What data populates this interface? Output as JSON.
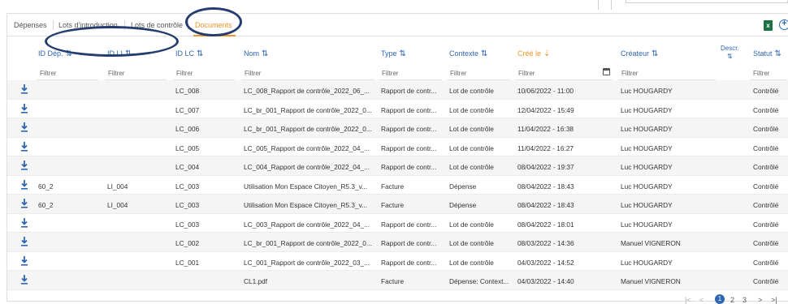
{
  "tabs": [
    "Dépenses",
    "Lots d'introduction",
    "Lots de contrôle",
    "Documents"
  ],
  "active_tab": "Documents",
  "toolbar": {
    "excel_icon": "excel-export-icon",
    "excel_glyph": "x",
    "add_icon": "add-circle-icon",
    "add_glyph": "+"
  },
  "columns": [
    {
      "key": "id_dep",
      "label": "ID Dép.",
      "sort": "⇅"
    },
    {
      "key": "id_li",
      "label": "ID LI",
      "sort": "⇅"
    },
    {
      "key": "id_lc",
      "label": "ID LC",
      "sort": "⇅"
    },
    {
      "key": "nom",
      "label": "Nom",
      "sort": "⇅"
    },
    {
      "key": "type",
      "label": "Type",
      "sort": "⇅"
    },
    {
      "key": "contexte",
      "label": "Contexte",
      "sort": "⇅"
    },
    {
      "key": "cree_le",
      "label": "Créé le",
      "sort": "⇣",
      "sorted": true
    },
    {
      "key": "createur",
      "label": "Créateur",
      "sort": "⇅"
    },
    {
      "key": "descr",
      "label": "Descr.",
      "sort": "⇅"
    },
    {
      "key": "statut",
      "label": "Statut",
      "sort": "⇅"
    }
  ],
  "filter_placeholder": "Filtrer",
  "download_icon": "download-icon",
  "calendar_icon": "calendar-icon",
  "rows": [
    {
      "id_dep": "",
      "id_li": "",
      "id_lc": "LC_008",
      "nom": "LC_008_Rapport de contrôle_2022_06_...",
      "type": "Rapport de contr...",
      "contexte": "Lot de contrôle",
      "cree_le": "10/06/2022 - 11:00",
      "createur": "Luc HOUGARDY",
      "statut": "Contrôlé"
    },
    {
      "id_dep": "",
      "id_li": "",
      "id_lc": "LC_007",
      "nom": "LC_br_001_Rapport de contrôle_2022_0...",
      "type": "Rapport de contr...",
      "contexte": "Lot de contrôle",
      "cree_le": "12/04/2022 - 15:49",
      "createur": "Luc HOUGARDY",
      "statut": "Contrôlé"
    },
    {
      "id_dep": "",
      "id_li": "",
      "id_lc": "LC_006",
      "nom": "LC_br_001_Rapport de contrôle_2022_0...",
      "type": "Rapport de contr...",
      "contexte": "Lot de contrôle",
      "cree_le": "11/04/2022 - 16:38",
      "createur": "Luc HOUGARDY",
      "statut": "Contrôlé"
    },
    {
      "id_dep": "",
      "id_li": "",
      "id_lc": "LC_005",
      "nom": "LC_005_Rapport de contrôle_2022_04_...",
      "type": "Rapport de contr...",
      "contexte": "Lot de contrôle",
      "cree_le": "11/04/2022 - 16:27",
      "createur": "Luc HOUGARDY",
      "statut": "Contrôlé"
    },
    {
      "id_dep": "",
      "id_li": "",
      "id_lc": "LC_004",
      "nom": "LC_004_Rapport de contrôle_2022_04_...",
      "type": "Rapport de contr...",
      "contexte": "Lot de contrôle",
      "cree_le": "08/04/2022 - 19:37",
      "createur": "Luc HOUGARDY",
      "statut": "Contrôlé"
    },
    {
      "id_dep": "60_2",
      "id_li": "LI_004",
      "id_lc": "LC_003",
      "nom": "Utilisation Mon Espace Citoyen_R5.3_v...",
      "type": "Facture",
      "contexte": "Dépense",
      "cree_le": "08/04/2022 - 18:43",
      "createur": "Luc HOUGARDY",
      "statut": "Contrôlé"
    },
    {
      "id_dep": "60_2",
      "id_li": "LI_004",
      "id_lc": "LC_003",
      "nom": "Utilisation Mon Espace Citoyen_R5.3_v...",
      "type": "Facture",
      "contexte": "Dépense",
      "cree_le": "08/04/2022 - 18:43",
      "createur": "Luc HOUGARDY",
      "statut": "Contrôlé"
    },
    {
      "id_dep": "",
      "id_li": "",
      "id_lc": "LC_003",
      "nom": "LC_003_Rapport de contrôle_2022_04_...",
      "type": "Rapport de contr...",
      "contexte": "Lot de contrôle",
      "cree_le": "08/04/2022 - 18:01",
      "createur": "Luc HOUGARDY",
      "statut": "Contrôlé"
    },
    {
      "id_dep": "",
      "id_li": "",
      "id_lc": "LC_002",
      "nom": "LC_br_001_Rapport de contrôle_2022_0...",
      "type": "Rapport de contr...",
      "contexte": "Lot de contrôle",
      "cree_le": "08/03/2022 - 14:36",
      "createur": "Manuel VIGNERON",
      "statut": "Contrôlé"
    },
    {
      "id_dep": "",
      "id_li": "",
      "id_lc": "LC_001",
      "nom": "LC_001_Rapport de contrôle_2022_03_...",
      "type": "Rapport de contr...",
      "contexte": "Lot de contrôle",
      "cree_le": "04/03/2022 - 14:52",
      "createur": "Luc HOUGARDY",
      "statut": "Contrôlé"
    },
    {
      "id_dep": "",
      "id_li": "",
      "id_lc": "",
      "nom": "CL1.pdf",
      "type": "Facture",
      "contexte": "Dépense: Context...",
      "cree_le": "04/03/2022 - 14:40",
      "createur": "Manuel VIGNERON",
      "statut": "Contrôlé"
    }
  ],
  "pagination": {
    "first": "|<",
    "prev": "<",
    "pages": [
      "1",
      "2",
      "3"
    ],
    "current": "1",
    "next": ">",
    "last": ">|"
  },
  "colors": {
    "accent": "#f0932b",
    "link": "#2f66b3",
    "annotation": "#243d6e",
    "excel": "#1d7044"
  }
}
